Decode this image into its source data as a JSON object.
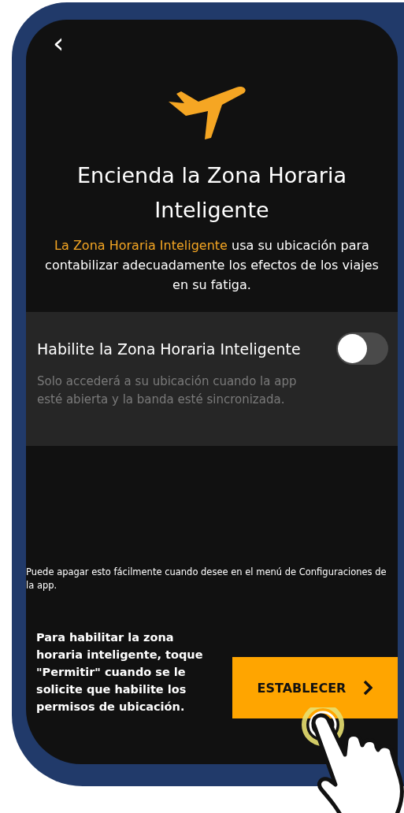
{
  "header": {
    "back": "‹"
  },
  "title": "Encienda la Zona Horaria Inteligente",
  "description": {
    "highlight": "La Zona Horaria Inteligente",
    "text": " usa su ubicación para contabilizar adecuadamente los efectos de los viajes en su fatiga."
  },
  "setting": {
    "label": "Habilite la Zona Horaria Inteligente",
    "on": false,
    "note": "Solo accederá a su ubicación cuando la app esté abierta y la banda esté sincronizada."
  },
  "footer_note": "Puede apagar esto fácilmente cuando desee en el menú de Configuraciones de la app.",
  "instruction": "Para habilitar la zona horaria inteligente, toque \"Permitir\" cuando se le solicite que habilite los permisos de ubicación.",
  "button": {
    "label": "ESTABLECER"
  }
}
